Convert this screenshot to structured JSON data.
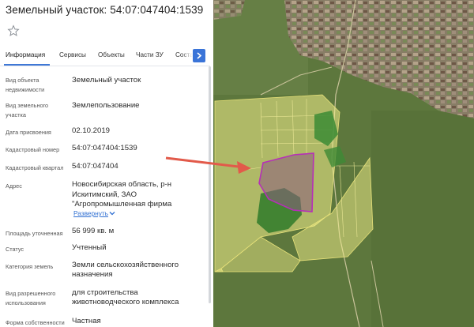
{
  "panel": {
    "title": "Земельный участок: 54:07:047404:1539",
    "tabs": [
      "Информация",
      "Сервисы",
      "Объекты",
      "Части ЗУ",
      "Состав"
    ],
    "active_tab": "Информация",
    "rows": [
      {
        "label": "Вид объекта недвижимости",
        "value": "Земельный участок"
      },
      {
        "label": "Вид земельного участка",
        "value": "Землепользование"
      },
      {
        "label": "Дата присвоения",
        "value": "02.10.2019"
      },
      {
        "label": "Кадастровый номер",
        "value": "54:07:047404:1539"
      },
      {
        "label": "Кадастровый квартал",
        "value": "54:07:047404"
      },
      {
        "label": "Адрес",
        "value": "Новосибирская область, р-н Искитимский, ЗАО \"Агропромышленная фирма"
      },
      {
        "label": "Площадь уточненная",
        "value": "56 999 кв. м"
      },
      {
        "label": "Статус",
        "value": "Учтенный"
      },
      {
        "label": "Категория земель",
        "value": "Земли сельскохозяйственного назначения"
      },
      {
        "label": "Вид разрешенного использования",
        "value": "для строительства животноводческого комплекса"
      },
      {
        "label": "Форма собственности",
        "value": "Частная"
      }
    ],
    "expand_label": "Развернуть"
  },
  "colors": {
    "accent": "#3a74d8",
    "link": "#2f6fd2",
    "parcel_outline": "#b62fb8",
    "arrow": "#e25a4a",
    "zone_fill": "#f3f08a"
  },
  "icons": [
    "star-icon",
    "chevron-right-icon",
    "chevron-down-icon",
    "arrow-icon"
  ]
}
